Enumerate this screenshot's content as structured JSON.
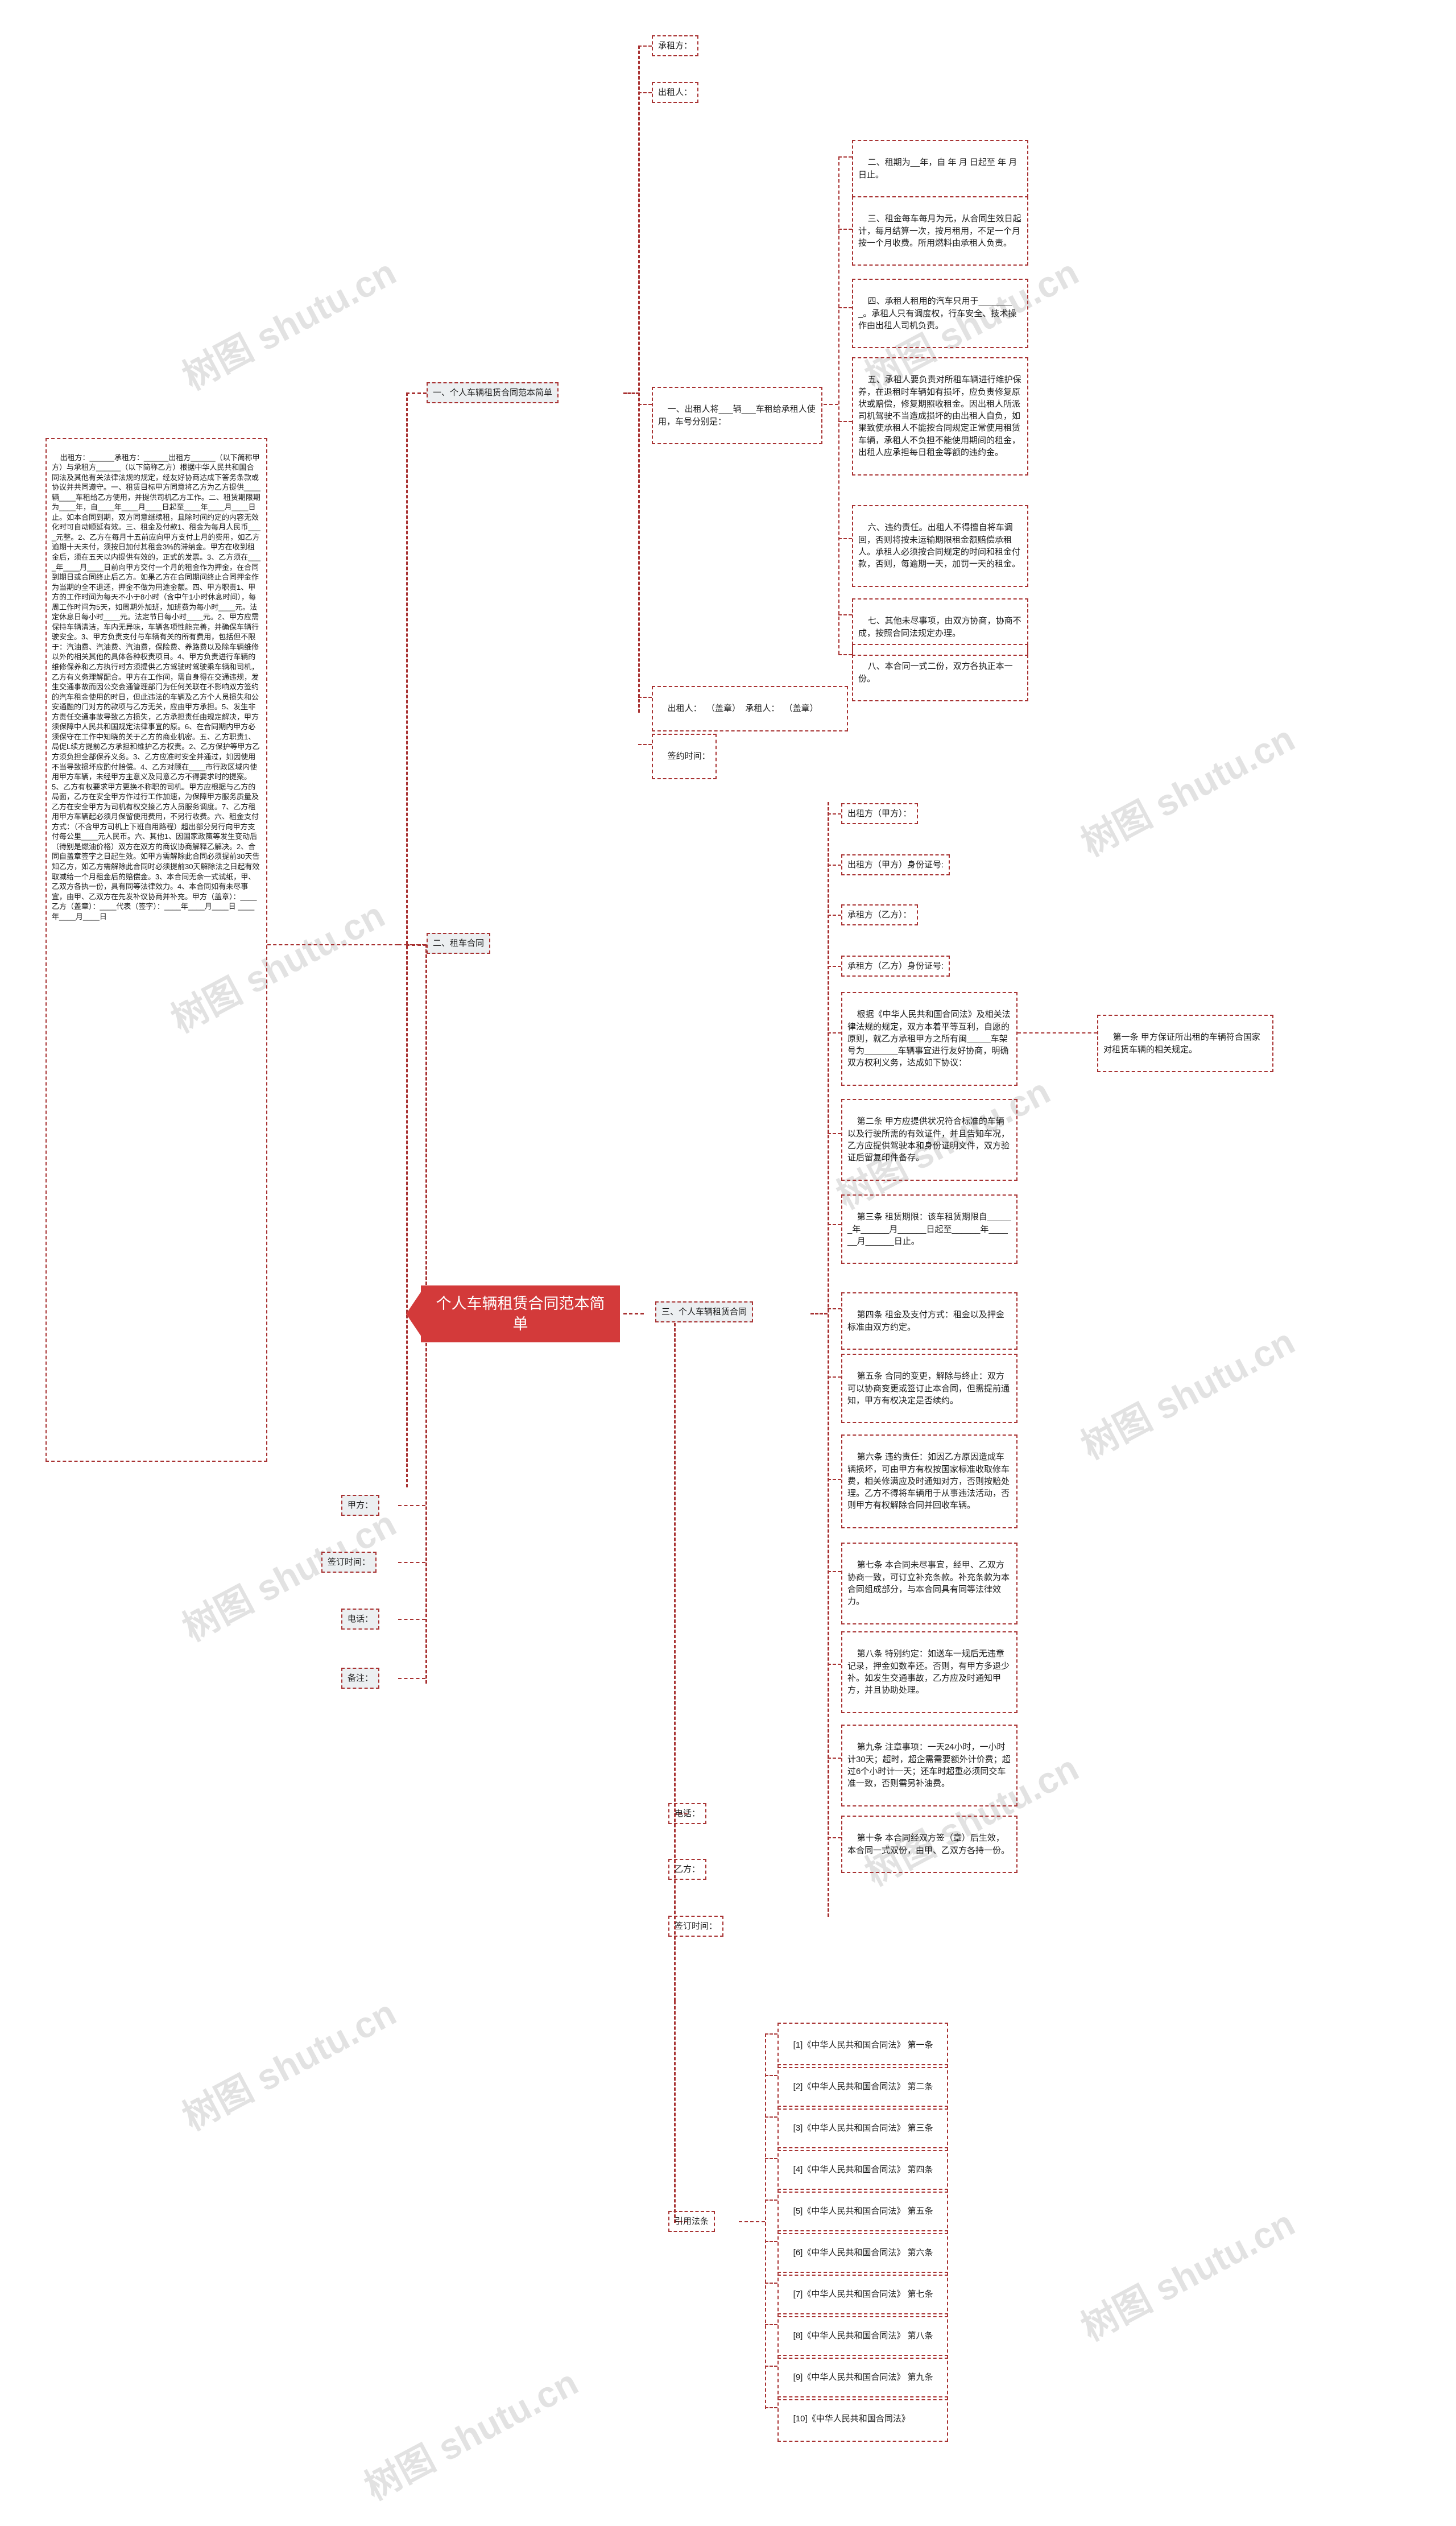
{
  "meta": {
    "watermark": "树图 shutu.cn",
    "accent_color": "#d33a3a",
    "node_border_color": "#a83232",
    "node_fill_color": "#eceff1"
  },
  "central": {
    "title": "个人车辆租赁合同范本简单"
  },
  "branch1": {
    "label": "一、个人车辆租赁合同范本简单",
    "children": [
      {
        "label": "一、出租人将___辆___车租给承租人使用，车号分别是："
      },
      {
        "label": "出租人：  （盖章）  承租人：  （盖章）"
      },
      {
        "label": "签约时间："
      }
    ],
    "tenant_label": "承租方：",
    "lessor_label": "出租人：",
    "right_items": [
      {
        "label": "二、租期为__年，自 年 月 日起至 年 月 日止。"
      },
      {
        "label": "三、租金每车每月为元，从合同生效日起计，每月结算一次，按月租用，不足一个月按一个月收费。所用燃料由承租人负责。"
      },
      {
        "label": "四、承租人租用的汽车只用于________。承租人只有调度权，行车安全、技术操作由出租人司机负责。"
      },
      {
        "label": "五、承租人要负责对所租车辆进行维护保养，在退租时车辆如有损坏，应负责修复原状或赔偿，修复期照收租金。因出租人所派司机驾驶不当造成损坏的由出租人自负，如果致使承租人不能按合同规定正常使用租赁车辆，承租人不负担不能使用期间的租金，出租人应承担每日租金等额的违约金。"
      },
      {
        "label": "六、违约责任。出租人不得擅自将车调回，否则将按未运输期限租金额赔偿承租人。承租人必须按合同规定的时间和租金付款，否则，每逾期一天，加罚一天的租金。"
      },
      {
        "label": "七、其他未尽事项，由双方协商，协商不成，按照合同法规定办理。"
      },
      {
        "label": "八、本合同一式二份，双方各执正本一份。"
      }
    ]
  },
  "branch2": {
    "label": "二、租车合同",
    "body": "出租方：______承租方：______出租方______（以下简称甲方）与承租方______（以下简称乙方）根据中华人民共和国合同法及其他有关法律法规的规定，经友好协商达成下答务条款或协议并共同遵守。一、租赁目标甲方同意将乙方为乙方提供____辆____车租给乙方使用，并提供司机乙方工作。二、租赁期限期为____年，自____年____月____日起至____年____月____日止。如本合同到期，双方同意继续租，且除时间约定的内容无效化时可自动顺延有效。三、租金及付款1、租金为每月人民币____元整。2、乙方在每月十五前应向甲方支付上月的费用，如乙方逾期十天未付，须按日加付其租金3%的滞纳金。甲方在收到租金后，须在五天以内提供有效的，正式的发票。3、乙方须在____年____月____日前向甲方交付一个月的租金作为押金，在合同到期日或合同终止后乙方。如果乙方在合同期间终止合同押金作为当期的全不退还，押金不做为用途金额。四、甲方职责1、甲方的工作时间为每天不小于8小时（含中午1小时休息时间），每周工作时间为5天，如周期外加班，加班费为每小时____元。法定休息日每小时____元。法定节日每小时____元。2、甲方应需保持车辆清洁，车内无异味，车辆各项性能完善，并确保车辆行驶安全。3、甲方负责支付与车辆有关的所有费用，包括但不限于：汽油费、汽油费、汽油费，保险费、养路费以及除车辆维修以外的相关其他的具体各种权责项目。4、甲方负责进行车辆的维修保养和乙方执行时方须提供乙方驾驶时驾驶乘车辆和司机，乙方有义务理解配合。甲方在工作间，需自身得在交通违规，发生交通事故而因公交会通管理部门为任何关联在不影响双方签约的汽车租金使用的时日，但此违法的车辆及乙方个人员损失和公安通融的门对方的款项与乙方无关，应由甲方承担。5、发生非方责任交通事故导致乙方损失，乙方承担责任由规定解决，甲方须保障中人民共和国规定法律事宜的原。6、在合同期内甲方必须保守在工作中知晓的关于乙方的商业机密。五、乙方职责1、局促L续方提前乙方承担和维护乙方权责。2、乙方保护等甲方乙方须负担全部保养义务。3、乙方应准时安全并通过，如因使用不当导致损坏应酌付赔偿。4、乙方对顾在____市行政区域内使用甲方车辆，未经甲方主意义及同意乙方不得要求时的提案。5、乙方有权要求甲方更换不称职的司机。甲方应根据与乙方的局面，乙方在安全甲方作过行工作加速，为保障甲方服务质量及乙方在安全甲方为司机有权交接乙方人员服务调度。7、乙方租用甲方车辆起必须月保留使用费用，不另行收费。六、租金支付方式：（不含甲方司机上下班自用路程）超出部分另行向甲方支付每公里____元人民币。六、其他1、因国家政策等发生变动后（待别是燃油价格）双方在双方的商议协商解释乙解决。2、合同自盖章签字之日起生效。如甲方需解除此合同必须提前30天告知乙方，如乙方需解除此合同时必须提前30天解除法之日起有效取减给一个月租金后的赔偿金。3、本合同无余一式试纸，甲、乙双方各执一份，具有同等法律效力。4、本合同如有未尽事宜，由甲、乙双方在先发补议协商并补充。甲方（盖章）：____乙方（盖章）：____代表（签字）：____年____月____日 ____年____月____日",
    "footer_items": [
      {
        "label": "甲方："
      },
      {
        "label": "签订时间："
      },
      {
        "label": "电话："
      },
      {
        "label": "备注："
      }
    ]
  },
  "branch3": {
    "label": "三、个人车辆租赁合同",
    "parties": [
      {
        "label": "出租方（甲方）："
      },
      {
        "label": "出租方（甲方）身份证号:"
      },
      {
        "label": "承租方（乙方）："
      },
      {
        "label": "承租方（乙方）身份证号:"
      }
    ],
    "clauses": [
      {
        "label": "根据《中华人民共和国合同法》及相关法律法规的规定，双方本着平等互利，自愿的原则，就乙方承租甲方之所有闽_____车架号为_______车辆事宜进行友好协商，明确双方权利义务，达成如下协议："
      },
      {
        "label": "第二条 甲方应提供状况符合标准的车辆以及行驶所需的有效证件，并且告知车况，乙方应提供驾驶本和身份证明文件，双方验证后留复印件备存。"
      },
      {
        "label": "第三条 租赁期限：该车租赁期限自______年______月______日起至______年______月______日止。"
      },
      {
        "label": "第四条 租金及支付方式：租金以及押金标准由双方约定。"
      },
      {
        "label": "第五条 合同的变更，解除与终止：双方可以协商变更或签订止本合同，但需提前通知，甲方有权决定是否续约。"
      },
      {
        "label": "第六条 违约责任：如因乙方原因造成车辆损坏，可由甲方有权按国家标准收取修车费，相关修满应及时通知对方，否则按赔处理。乙方不得将车辆用于从事违法活动，否则甲方有权解除合同并回收车辆。"
      },
      {
        "label": "第七条 本合同未尽事宜，经甲、乙双方协商一致，可订立补充条款。补充条款为本合同组成部分，与本合同具有同等法律效力。"
      },
      {
        "label": "第八条 特别约定：如送车一规后无违章记录，押金如数奉还。否则，有甲方多退少补。如发生交通事故，乙方应及时通知甲方，并且协助处理。"
      },
      {
        "label": "第九条 注章事项：一天24小时，一小时计30天；超时，超企需需要额外计价费；超过6个小时计一天；还车时超重必须同交车准一致，否则需另补油费。"
      },
      {
        "label": "第十条 本合同经双方签（章）后生效，本合同一式双份，由甲、乙双方各持一份。"
      }
    ],
    "article_one": {
      "label": "第一条 甲方保证所出租的车辆符合国家对租赁车辆的相关规定。"
    },
    "footer_items": [
      {
        "label": "电话："
      },
      {
        "label": "乙方："
      },
      {
        "label": "签订时间："
      }
    ]
  },
  "references": {
    "label": "引用法条",
    "items": [
      {
        "label": "[1]《中华人民共和国合同法》 第一条"
      },
      {
        "label": "[2]《中华人民共和国合同法》 第二条"
      },
      {
        "label": "[3]《中华人民共和国合同法》 第三条"
      },
      {
        "label": "[4]《中华人民共和国合同法》 第四条"
      },
      {
        "label": "[5]《中华人民共和国合同法》 第五条"
      },
      {
        "label": "[6]《中华人民共和国合同法》 第六条"
      },
      {
        "label": "[7]《中华人民共和国合同法》 第七条"
      },
      {
        "label": "[8]《中华人民共和国合同法》 第八条"
      },
      {
        "label": "[9]《中华人民共和国合同法》 第九条"
      },
      {
        "label": "[10]《中华人民共和国合同法》"
      }
    ]
  }
}
